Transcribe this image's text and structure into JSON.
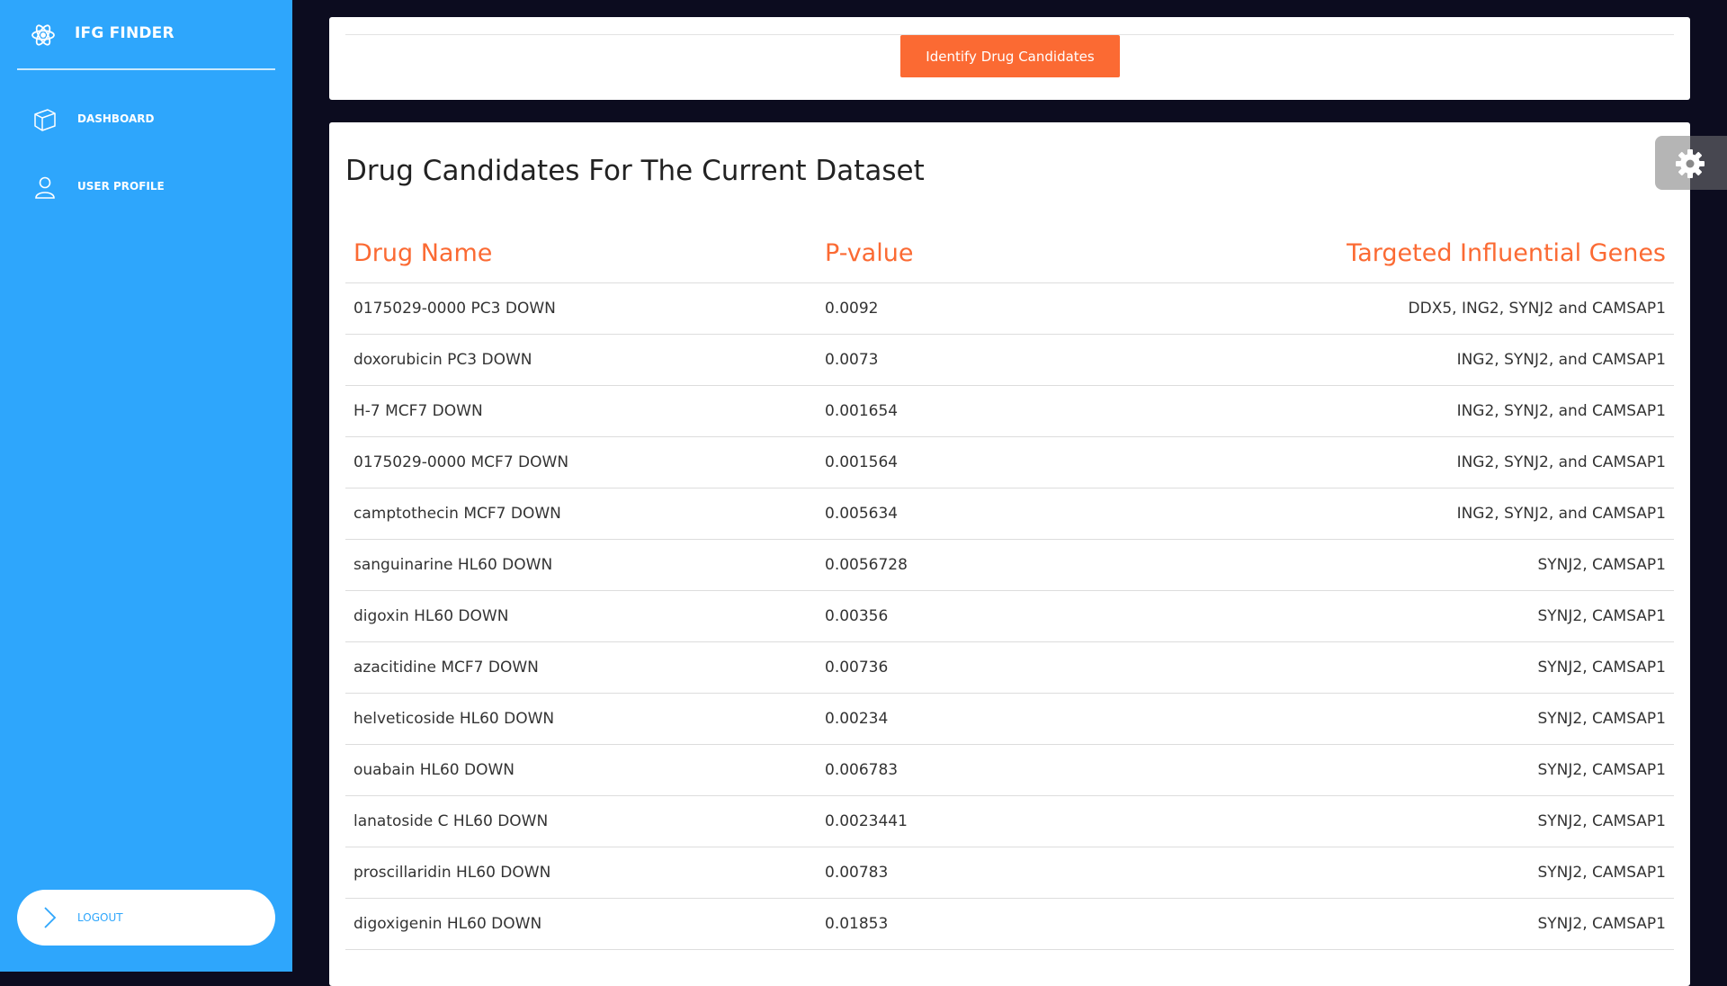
{
  "sidebar": {
    "brand": "IFG FINDER",
    "items": [
      {
        "label": "DASHBOARD",
        "icon": "cube-icon"
      },
      {
        "label": "USER PROFILE",
        "icon": "user-icon"
      }
    ],
    "logout_label": "LOGOUT"
  },
  "toolbar": {
    "identify_label": "Identify Drug Candidates"
  },
  "results": {
    "title": "Drug Candidates For The Current Dataset",
    "columns": [
      "Drug Name",
      "P-value",
      "Targeted Influential Genes"
    ],
    "rows": [
      [
        "0175029-0000 PC3 DOWN",
        "0.0092",
        "DDX5, ING2, SYNJ2 and CAMSAP1"
      ],
      [
        "doxorubicin PC3 DOWN",
        "0.0073",
        "ING2, SYNJ2, and CAMSAP1"
      ],
      [
        "H-7 MCF7 DOWN",
        "0.001654",
        "ING2, SYNJ2, and CAMSAP1"
      ],
      [
        "0175029-0000 MCF7 DOWN",
        "0.001564",
        "ING2, SYNJ2, and CAMSAP1"
      ],
      [
        "camptothecin MCF7 DOWN",
        "0.005634",
        "ING2, SYNJ2, and CAMSAP1"
      ],
      [
        "sanguinarine HL60 DOWN",
        "0.0056728",
        "SYNJ2, CAMSAP1"
      ],
      [
        "digoxin HL60 DOWN",
        "0.00356",
        "SYNJ2, CAMSAP1"
      ],
      [
        "azacitidine MCF7 DOWN",
        "0.00736",
        "SYNJ2, CAMSAP1"
      ],
      [
        "helveticoside HL60 DOWN",
        "0.00234",
        "SYNJ2, CAMSAP1"
      ],
      [
        "ouabain HL60 DOWN",
        "0.006783",
        "SYNJ2, CAMSAP1"
      ],
      [
        "lanatoside C HL60 DOWN",
        "0.0023441",
        "SYNJ2, CAMSAP1"
      ],
      [
        "proscillaridin HL60 DOWN",
        "0.00783",
        "SYNJ2, CAMSAP1"
      ],
      [
        "digoxigenin HL60 DOWN",
        "0.01853",
        "SYNJ2, CAMSAP1"
      ]
    ]
  },
  "colors": {
    "sidebar_bg": "#2ea6fc",
    "accent": "#fb6a33",
    "page_bg": "#0c0c1f",
    "card_bg": "#ffffff"
  },
  "icons": {
    "brand": "atom-icon",
    "logout": "chevron-right-icon",
    "settings": "gear-icon"
  }
}
